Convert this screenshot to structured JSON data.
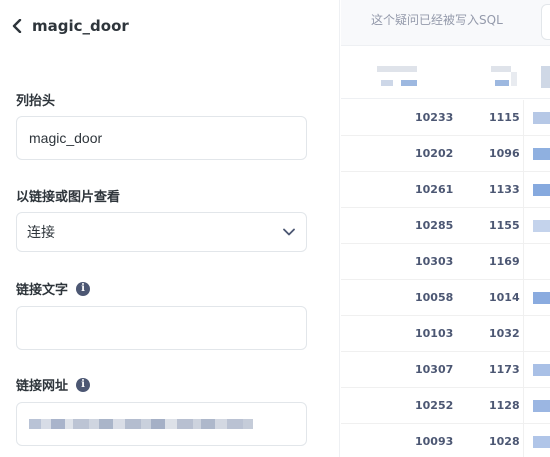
{
  "panel": {
    "title": "magic_door",
    "fields": [
      {
        "label": "列抬头",
        "value": "magic_door"
      },
      {
        "label": "以链接或图片查看",
        "selected": "连接"
      },
      {
        "label": "链接文字",
        "value": ""
      },
      {
        "label": "链接网址",
        "value": ""
      }
    ]
  },
  "results": {
    "notice": "这个疑问已经被写入SQL",
    "rows": [
      {
        "id": "10233",
        "value": "1115"
      },
      {
        "id": "10202",
        "value": "1096"
      },
      {
        "id": "10261",
        "value": "1133"
      },
      {
        "id": "10285",
        "value": "1155"
      },
      {
        "id": "10303",
        "value": "1169"
      },
      {
        "id": "10058",
        "value": "1014"
      },
      {
        "id": "10103",
        "value": "1032"
      },
      {
        "id": "10307",
        "value": "1173"
      },
      {
        "id": "10252",
        "value": "1128"
      },
      {
        "id": "10093",
        "value": "1028"
      }
    ]
  },
  "colors": {
    "accent": "#509ee3",
    "text": "#2e353b",
    "muted": "#949aab",
    "border": "#e2e6ea"
  }
}
